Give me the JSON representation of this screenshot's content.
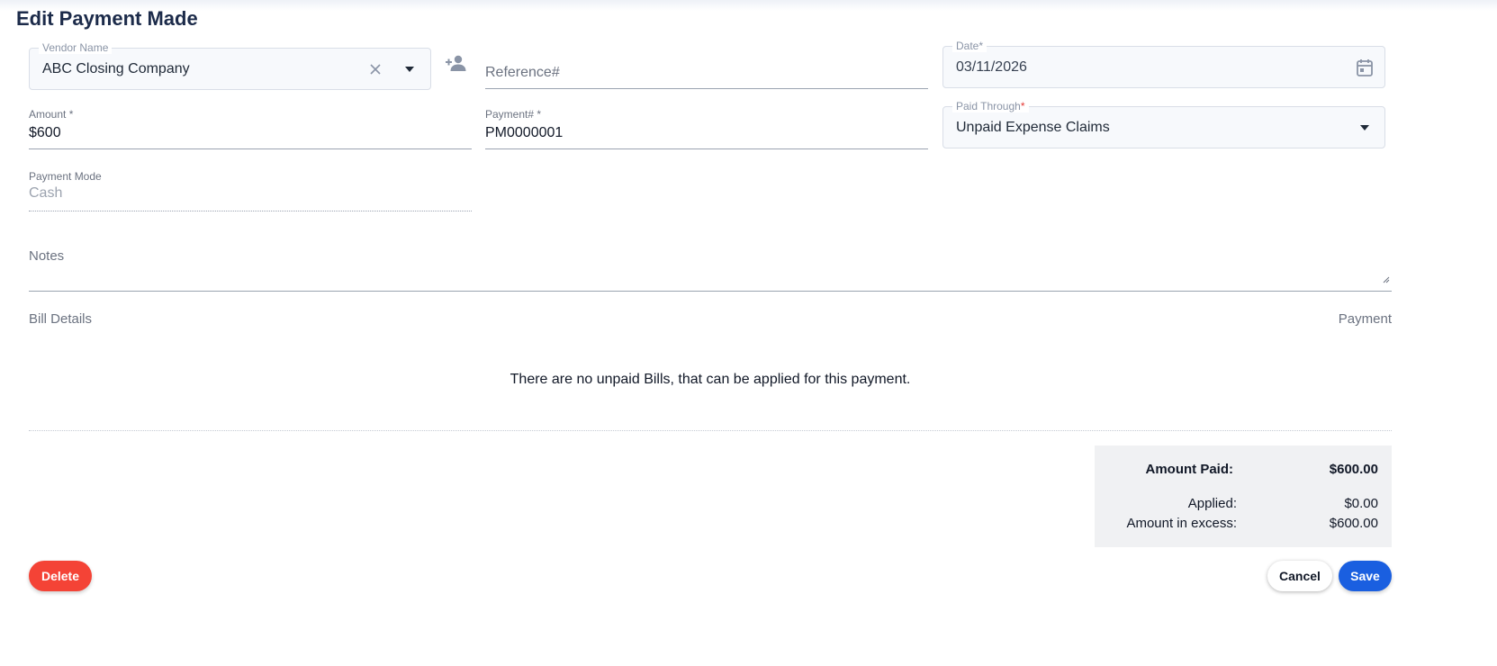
{
  "page": {
    "title": "Edit Payment Made"
  },
  "form": {
    "vendor": {
      "label": "Vendor Name",
      "value": "ABC Closing Company"
    },
    "reference": {
      "placeholder": "Reference#"
    },
    "date": {
      "label": "Date",
      "required_mark": "*",
      "value": "03/11/2026"
    },
    "amount": {
      "label": "Amount",
      "required_mark": "*",
      "value": "$600"
    },
    "payment_number": {
      "label": "Payment#",
      "required_mark": "*",
      "value": "PM0000001"
    },
    "paid_through": {
      "label": "Paid Through",
      "required_mark": "*",
      "value": "Unpaid Expense Claims"
    },
    "payment_mode": {
      "label": "Payment Mode",
      "value": "Cash"
    },
    "notes": {
      "placeholder": "Notes"
    }
  },
  "bills": {
    "header_left": "Bill Details",
    "header_right": "Payment",
    "empty_message": "There are no unpaid Bills, that can be applied for this payment."
  },
  "summary": {
    "amount_paid_label": "Amount Paid:",
    "amount_paid_value": "$600.00",
    "applied_label": "Applied:",
    "applied_value": "$0.00",
    "excess_label": "Amount in excess:",
    "excess_value": "$600.00"
  },
  "actions": {
    "delete_label": "Delete",
    "cancel_label": "Cancel",
    "save_label": "Save"
  },
  "icons": {
    "clear": "close-icon",
    "dropdown": "caret-down-icon",
    "add_vendor": "person-add-icon",
    "calendar": "calendar-icon"
  },
  "colors": {
    "primary": "#1a5fe0",
    "danger": "#f44336",
    "required": "#e53935"
  }
}
